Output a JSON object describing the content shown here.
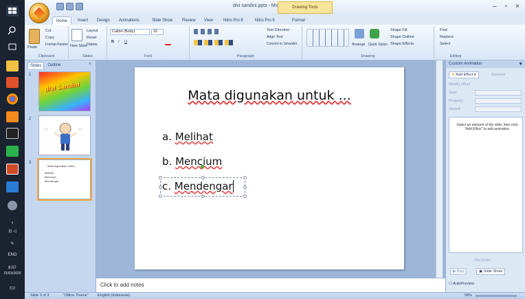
{
  "taskbar": {
    "time": "6:07",
    "date": "21/03/2020",
    "lang": "ENG"
  },
  "titlebar": {
    "title": "divi sandini.pptx - Microsoft PowerPoint",
    "contextual": "Drawing Tools"
  },
  "tabs": [
    "Home",
    "Insert",
    "Design",
    "Animations",
    "Slide Show",
    "Review",
    "View",
    "Nitro Pro 8",
    "Nitro Pro 9",
    "Format"
  ],
  "ribbon": {
    "clipboard": {
      "label": "Clipboard",
      "paste": "Paste",
      "cut": "Cut",
      "copy": "Copy",
      "format_painter": "Format Painter"
    },
    "slides": {
      "label": "Slides",
      "new_slide": "New Slide",
      "layout": "Layout",
      "reset": "Reset",
      "delete": "Delete"
    },
    "font": {
      "label": "Font",
      "family": "Calibri (Body)",
      "size": "16"
    },
    "paragraph": {
      "label": "Paragraph",
      "text_direction": "Text Direction",
      "align_text": "Align Text",
      "smartart": "Convert to SmartArt"
    },
    "drawing": {
      "label": "Drawing",
      "arrange": "Arrange",
      "quick_styles": "Quick Styles",
      "shape_fill": "Shape Fill",
      "shape_outline": "Shape Outline",
      "shape_effects": "Shape Effects"
    },
    "editing": {
      "label": "Editing",
      "find": "Find",
      "replace": "Replace",
      "select": "Select"
    }
  },
  "slides_pane": {
    "tab_slides": "Slides",
    "tab_outline": "Outline",
    "thumbs": [
      {
        "num": "1",
        "text": "divi Sandini"
      },
      {
        "num": "2"
      },
      {
        "num": "3",
        "title": "Mata digunakan untuk ...",
        "items": [
          "Melihat",
          "Mencium",
          "Mendengar"
        ]
      }
    ]
  },
  "slide": {
    "title": "Mata digunakan untuk ...",
    "bullets": [
      {
        "prefix": "a.",
        "text": "Melihat"
      },
      {
        "prefix": "b.",
        "text": "Mencium"
      },
      {
        "prefix": "c.",
        "text": "Mendengar"
      }
    ]
  },
  "notes_placeholder": "Click to add notes",
  "anim_pane": {
    "title": "Custom Animation",
    "add_effect": "Add Effect",
    "remove": "Remove",
    "modify": "Modify effect",
    "start": "Start:",
    "property": "Property:",
    "speed": "Speed:",
    "message": "Select an element of the slide, then click \"Add Effect\" to add animation.",
    "reorder": "Re-Order",
    "play": "Play",
    "slide_show": "Slide Show",
    "autopreview": "AutoPreview"
  },
  "status": {
    "slide": "Slide 3 of 3",
    "theme": "\"Office Theme\"",
    "language": "English (Indonesia)",
    "zoom": "58%"
  }
}
